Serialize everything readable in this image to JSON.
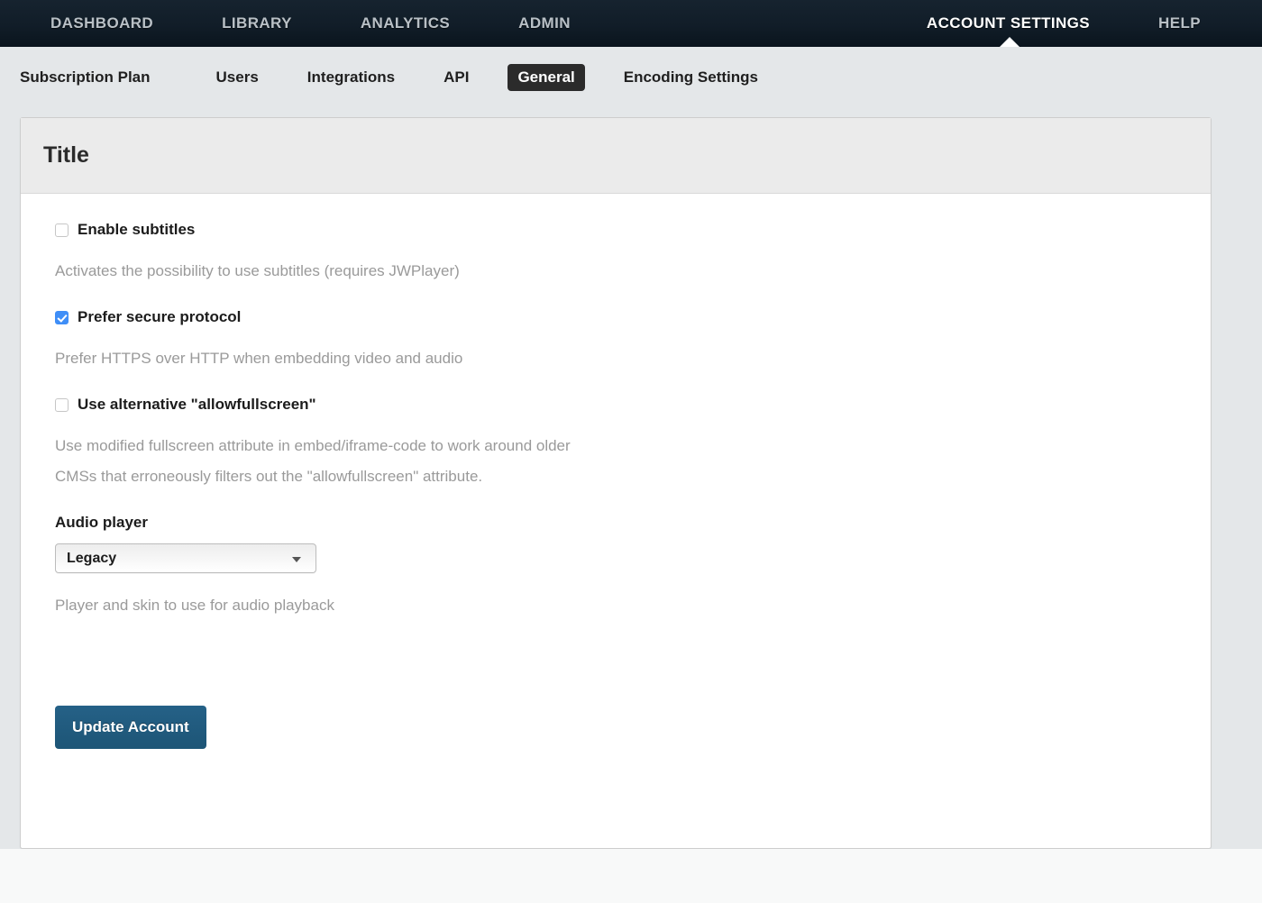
{
  "topnav": {
    "left_items": [
      {
        "label": "DASHBOARD",
        "active": false
      },
      {
        "label": "LIBRARY",
        "active": false
      },
      {
        "label": "ANALYTICS",
        "active": false
      },
      {
        "label": "ADMIN",
        "active": false
      }
    ],
    "right_items": [
      {
        "label": "ACCOUNT SETTINGS",
        "active": true
      },
      {
        "label": "HELP",
        "active": false
      }
    ]
  },
  "subnav": {
    "items": [
      {
        "label": "Subscription Plan",
        "active": false
      },
      {
        "label": "Users",
        "active": false
      },
      {
        "label": "Integrations",
        "active": false
      },
      {
        "label": "API",
        "active": false
      },
      {
        "label": "General",
        "active": true
      },
      {
        "label": "Encoding Settings",
        "active": false
      }
    ]
  },
  "panel": {
    "title": "Title",
    "fields": [
      {
        "type": "checkbox",
        "name": "enable-subtitles",
        "label": "Enable subtitles",
        "checked": false,
        "help": "Activates the possibility to use subtitles (requires JWPlayer)"
      },
      {
        "type": "checkbox",
        "name": "prefer-secure-protocol",
        "label": "Prefer secure protocol",
        "checked": true,
        "help": "Prefer HTTPS over HTTP when embedding video and audio"
      },
      {
        "type": "checkbox",
        "name": "use-alternative-allowfullscreen",
        "label": "Use alternative \"allowfullscreen\"",
        "checked": false,
        "help": "Use modified fullscreen attribute in embed/iframe-code to work around older CMSs that erroneously filters out the \"allowfullscreen\" attribute."
      },
      {
        "type": "select",
        "name": "audio-player",
        "label": "Audio player",
        "value": "Legacy",
        "options": [
          "Legacy"
        ],
        "help": "Player and skin to use for audio playback"
      }
    ],
    "submit_label": "Update Account"
  },
  "colors": {
    "navbar": "#111d28",
    "page_background": "#e4e7e9",
    "panel_header": "#ebebeb",
    "accent_checkbox": "#3f8ef7",
    "primary_button": "#1d5576",
    "active_tab": "#2b2b2b",
    "help_text": "#9a9a9a"
  }
}
